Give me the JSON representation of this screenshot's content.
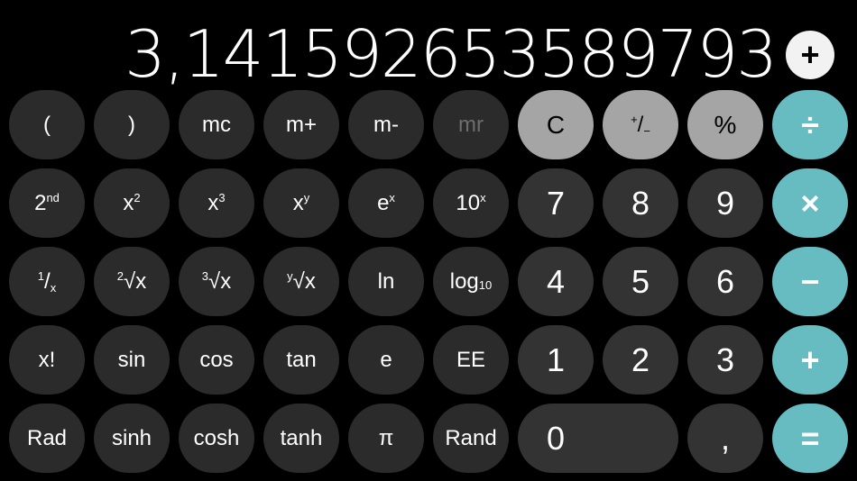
{
  "display": {
    "value": "3,141592653589793",
    "add_label": "+"
  },
  "keys": {
    "lparen": "(",
    "rparen": ")",
    "mc": "mc",
    "mplus": "m+",
    "mminus": "m-",
    "mr": "mr",
    "clear": "C",
    "plusminus_top": "+",
    "plusminus_bottom": "−",
    "percent": "%",
    "divide": "÷",
    "second": "2",
    "second_sup": "nd",
    "x": "x",
    "sup2": "2",
    "sup3": "3",
    "supy": "y",
    "e": "e",
    "ten": "10",
    "n1": "1",
    "n2": "2",
    "n3": "3",
    "n4": "4",
    "n5": "5",
    "n6": "6",
    "n7": "7",
    "n8": "8",
    "n9": "9",
    "n0": "0",
    "multiply": "×",
    "minus": "−",
    "plus": "+",
    "equals": "=",
    "inv_num": "1",
    "inv_den": "x",
    "sqrt2_index": "2",
    "sqrt3_index": "3",
    "sqrty_index": "y",
    "radical": "√x",
    "ln": "ln",
    "log": "log",
    "log_sub": "10",
    "factorial": "x!",
    "sin": "sin",
    "cos": "cos",
    "tan": "tan",
    "e_const": "e",
    "EE": "EE",
    "rad": "Rad",
    "sinh": "sinh",
    "cosh": "cosh",
    "tanh": "tanh",
    "pi": "π",
    "rand": "Rand",
    "decimal": ","
  },
  "colors": {
    "background": "#000000",
    "key_dark": "#2b2b2b",
    "key_number": "#333333",
    "key_function": "#a5a5a5",
    "key_operator": "#67bcc2"
  }
}
